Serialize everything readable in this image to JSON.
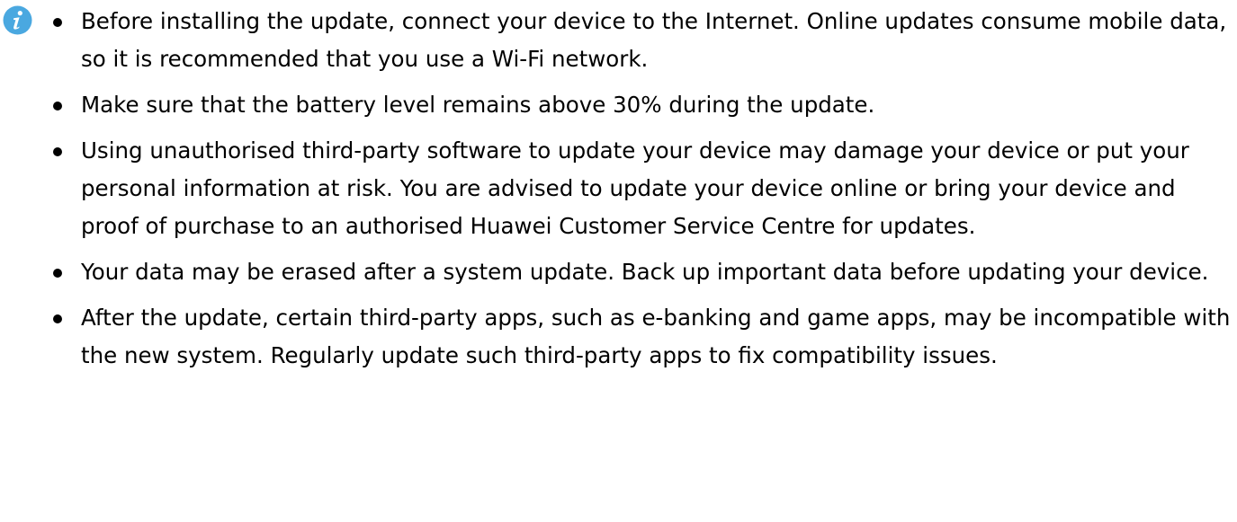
{
  "note": {
    "icon": "info-icon",
    "icon_color": "#4aa8e0",
    "items": [
      "Before installing the update, connect your device to the Internet. Online updates consume mobile data, so it is recommended that you use a Wi-Fi network.",
      "Make sure that the battery level remains above 30% during the update.",
      "Using unauthorised third-party software to update your device may damage your device or put your personal information at risk. You are advised to update your device online or bring your device and proof of purchase to an authorised Huawei Customer Service Centre for updates.",
      "Your data may be erased after a system update. Back up important data before updating your device.",
      "After the update, certain third-party apps, such as e-banking and game apps, may be incompatible with the new system. Regularly update such third-party apps to fix compatibility issues."
    ]
  }
}
